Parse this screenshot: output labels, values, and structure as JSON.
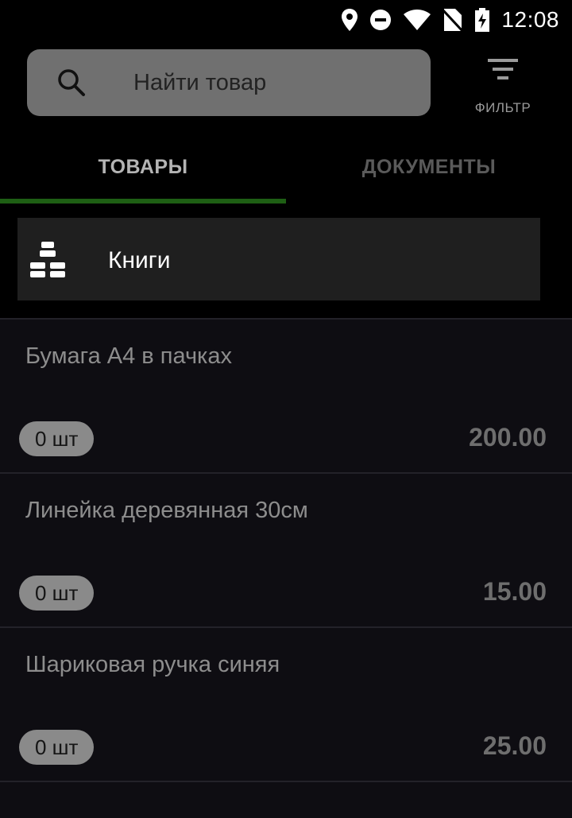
{
  "status_bar": {
    "time": "12:08",
    "icons": [
      "location-icon",
      "do-not-disturb-icon",
      "wifi-icon",
      "no-sim-icon",
      "battery-charging-icon"
    ]
  },
  "search": {
    "placeholder": "Найти товар",
    "icon": "search-icon"
  },
  "filter": {
    "label": "ФИЛЬТР",
    "icon": "filter-icon"
  },
  "tabs": [
    {
      "label": "ТОВАРЫ",
      "active": true
    },
    {
      "label": "ДОКУМЕНТЫ",
      "active": false
    }
  ],
  "category": {
    "label": "Книги",
    "icon": "boxes-icon"
  },
  "products": [
    {
      "name": "Бумага А4 в пачках",
      "quantity": "0 шт",
      "price": "200.00"
    },
    {
      "name": "Линейка деревянная 30см",
      "quantity": "0 шт",
      "price": "15.00"
    },
    {
      "name": "Шариковая ручка синяя",
      "quantity": "0 шт",
      "price": "25.00"
    }
  ],
  "colors": {
    "background": "#0e0d12",
    "header_background": "#000000",
    "accent": "#1e5f14",
    "search_background": "#707070"
  }
}
